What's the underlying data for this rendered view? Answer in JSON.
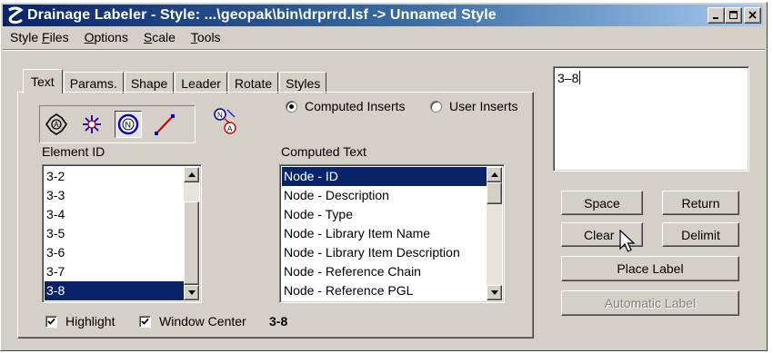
{
  "window": {
    "title": "Drainage Labeler - Style: ...\\geopak\\bin\\drprrd.lsf -> Unnamed Style",
    "controls": [
      "minimize",
      "maximize",
      "close"
    ]
  },
  "menu": [
    {
      "label": "Style Files",
      "mnemonic": "F"
    },
    {
      "label": "Options",
      "mnemonic": "O"
    },
    {
      "label": "Scale",
      "mnemonic": "S"
    },
    {
      "label": "Tools",
      "mnemonic": "T"
    }
  ],
  "tabs": [
    "Text",
    "Params.",
    "Shape",
    "Leader",
    "Rotate",
    "Styles"
  ],
  "active_tab": "Text",
  "element_types": [
    {
      "icon": "inlet-icon",
      "pressed": false
    },
    {
      "icon": "outlet-icon",
      "pressed": false
    },
    {
      "icon": "node-icon",
      "pressed": true
    },
    {
      "icon": "link-icon",
      "pressed": false
    }
  ],
  "insert_mode": {
    "computed_label": "Computed Inserts",
    "user_label": "User Inserts",
    "selected": "computed"
  },
  "element_id": {
    "label": "Element ID",
    "items": [
      "3-2",
      "3-3",
      "3-4",
      "3-5",
      "3-6",
      "3-7",
      "3-8"
    ],
    "selected": "3-8"
  },
  "computed_text": {
    "label": "Computed Text",
    "items": [
      "Node - ID",
      "Node - Description",
      "Node - Type",
      "Node - Library Item Name",
      "Node - Library Item Description",
      "Node - Reference Chain",
      "Node - Reference PGL"
    ],
    "selected": "Node - ID"
  },
  "highlight": {
    "label": "Highlight",
    "checked": true
  },
  "window_center": {
    "label": "Window Center",
    "checked": true
  },
  "current_id": "3-8",
  "label_text": "3–8",
  "buttons": {
    "space": "Space",
    "return": "Return",
    "clear": "Clear",
    "delimit": "Delimit",
    "place_label": "Place Label",
    "automatic_label": "Automatic Label"
  },
  "colors": {
    "title_start": "#0a246a",
    "title_end": "#a6caf0",
    "face": "#d4d0c8",
    "selection": "#0a246a"
  }
}
